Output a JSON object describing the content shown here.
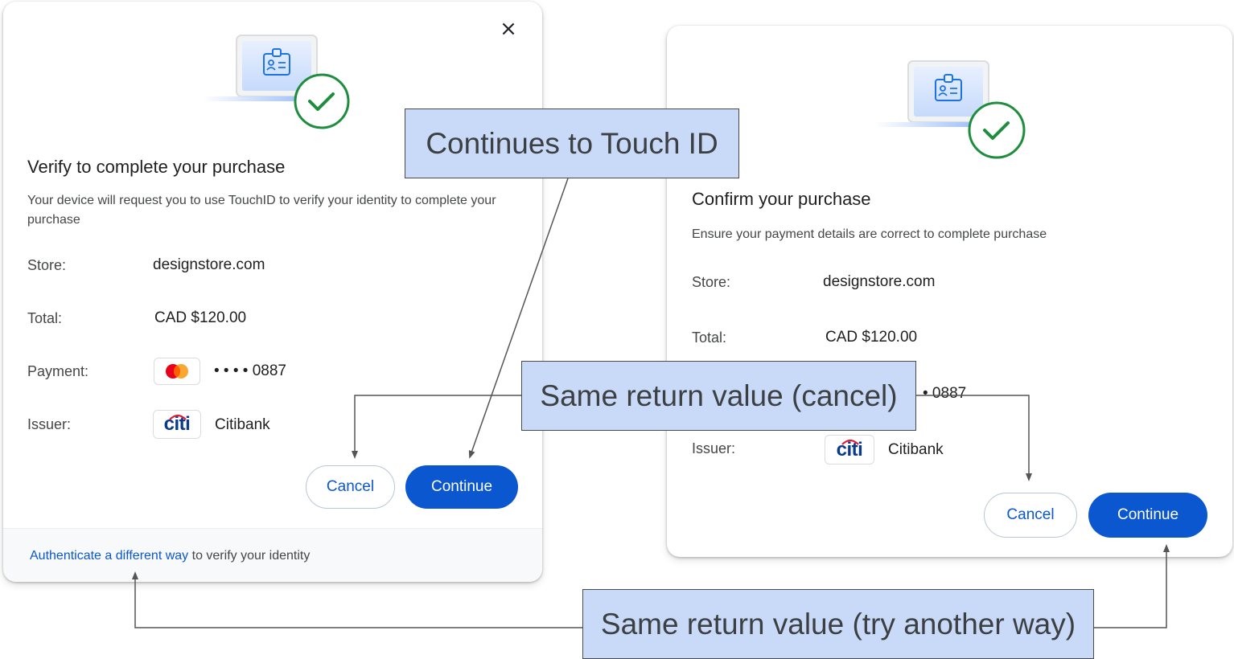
{
  "left_dialog": {
    "close_glyph": "×",
    "title": "Verify to complete your purchase",
    "description": "Your device will request you to use TouchID to verify your identity to complete your purchase",
    "store": {
      "label": "Store:",
      "value": "designstore.com"
    },
    "total": {
      "label": "Total:",
      "value": "CAD $120.00"
    },
    "payment": {
      "label": "Payment:",
      "value": "• • • • 0887",
      "icon": "mastercard-icon"
    },
    "issuer": {
      "label": "Issuer:",
      "value": "Citibank",
      "icon": "citi-logo",
      "logo_text": "citi"
    },
    "cancel_label": "Cancel",
    "continue_label": "Continue",
    "footer": {
      "link_text": "Authenticate a different way",
      "rest_text": " to verify your identity"
    }
  },
  "right_dialog": {
    "title": "Confirm your purchase",
    "description": "Ensure your payment details are correct to complete purchase",
    "store": {
      "label": "Store:",
      "value": "designstore.com"
    },
    "total": {
      "label": "Total:",
      "value": "CAD $120.00"
    },
    "payment": {
      "value_partial": "• 0887"
    },
    "issuer": {
      "label": "Issuer:",
      "value": "Citibank",
      "icon": "citi-logo",
      "logo_text": "citi"
    },
    "cancel_label": "Cancel",
    "continue_label": "Continue"
  },
  "annotations": {
    "touch_id": "Continues to Touch ID",
    "cancel": "Same return value (cancel)",
    "try_another": "Same return value (try another way)"
  },
  "colors": {
    "primary": "#0b57d0",
    "success": "#1e8e3e",
    "annotation_fill": "#c9daf8",
    "mastercard_red": "#eb001b",
    "mastercard_orange": "#f79e1b"
  }
}
